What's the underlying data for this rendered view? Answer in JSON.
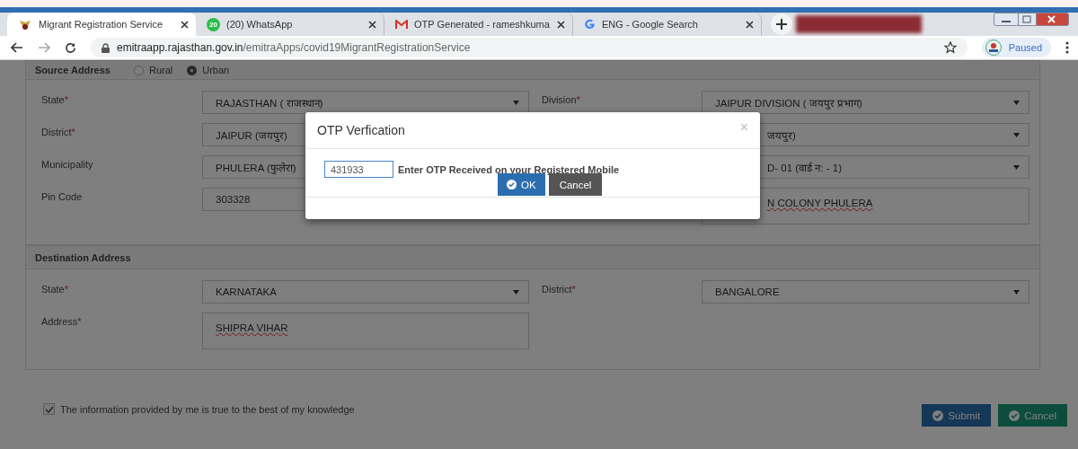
{
  "browser": {
    "tabs": [
      {
        "kind": "site",
        "title": "Migrant Registration Service",
        "selected": true
      },
      {
        "kind": "chat",
        "badge": "20",
        "title": "(20) WhatsApp",
        "selected": false
      },
      {
        "kind": "mail",
        "title": "OTP Generated - rameshkuma",
        "selected": false
      },
      {
        "kind": "search",
        "title": "ENG - Google Search",
        "selected": false
      }
    ],
    "url_host": "emitraapp.rajasthan.gov.in",
    "url_path": "/emitraApps/covid19MigrantRegistrationService",
    "profile_status": "Paused"
  },
  "source_address": {
    "title": "Source Address",
    "options": [
      {
        "label": "Rural",
        "selected": false
      },
      {
        "label": "Urban",
        "selected": true
      }
    ],
    "rows": [
      {
        "left": {
          "label": "State",
          "required_mark": "*",
          "kind": "select",
          "value": "RAJASTHAN ( राजस्थान)"
        },
        "right": {
          "label": "Division",
          "required_mark": "*",
          "kind": "select",
          "value": "JAIPUR DIVISION ( जयपुर प्रभाग)"
        }
      },
      {
        "left": {
          "label": "District",
          "required_mark": "*",
          "kind": "select",
          "value": "JAIPUR (जयपुर)"
        },
        "right": {
          "kind": "select",
          "value": "जयपुर)"
        }
      },
      {
        "left": {
          "label": "Municipality",
          "kind": "select",
          "value": "PHULERA (फुलेरा)"
        },
        "right": {
          "kind": "select",
          "value": "D- 01 (वार्ड न: - 1)"
        }
      },
      {
        "left": {
          "label": "Pin Code",
          "kind": "text",
          "value": "303328"
        },
        "right": {
          "kind": "textarea",
          "value": "N COLONY PHULERA"
        }
      }
    ]
  },
  "destination_address": {
    "title": "Destination Address",
    "rows": [
      {
        "left": {
          "label": "State",
          "required_mark": "*",
          "kind": "select",
          "value": "KARNATAKA"
        },
        "right": {
          "label": "District",
          "required_mark": "*",
          "kind": "select",
          "value": "BANGALORE"
        }
      },
      {
        "left": {
          "label": "Address",
          "required_mark": "*",
          "kind": "textarea",
          "value": "SHIPRA VIHAR"
        }
      }
    ]
  },
  "declaration": {
    "checked": true,
    "text": "The information provided by me is true to the best of my knowledge"
  },
  "buttons": {
    "submit": "Submit",
    "cancel": "Cancel"
  },
  "otp_dialog": {
    "title": "OTP Verfication",
    "close": "×",
    "otp": "431933",
    "prompt": "Enter OTP Received on your Registered Mobile",
    "ok": "OK",
    "cancel": "Cancel"
  }
}
